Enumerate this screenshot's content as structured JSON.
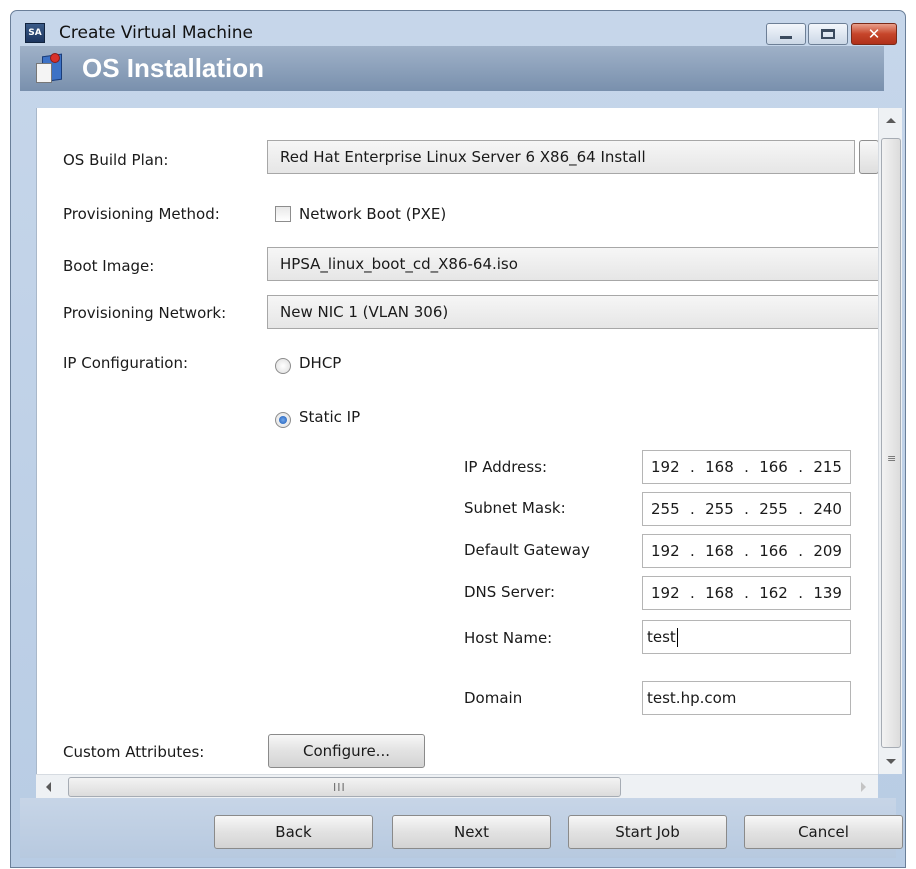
{
  "window": {
    "app_badge": "SA",
    "title": "Create Virtual Machine",
    "close_glyph": "✕"
  },
  "header": {
    "icon": "install-books-icon",
    "title": "OS Installation"
  },
  "form": {
    "os_build_plan": {
      "label": "OS Build Plan:",
      "value": "Red Hat Enterprise Linux Server 6 X86_64 Install"
    },
    "provisioning_method": {
      "label": "Provisioning Method:",
      "checkbox_label": "Network Boot (PXE)",
      "checked": false
    },
    "boot_image": {
      "label": "Boot Image:",
      "value": "HPSA_linux_boot_cd_X86-64.iso"
    },
    "provisioning_network": {
      "label": "Provisioning Network:",
      "value": "New NIC 1 (VLAN 306)"
    },
    "ip_configuration": {
      "label": "IP Configuration:",
      "options": [
        {
          "label": "DHCP",
          "selected": false
        },
        {
          "label": "Static IP",
          "selected": true
        }
      ]
    },
    "static": {
      "ip_address": {
        "label": "IP Address:",
        "octets": [
          "192",
          "168",
          "166",
          "215"
        ]
      },
      "subnet_mask": {
        "label": "Subnet Mask:",
        "octets": [
          "255",
          "255",
          "255",
          "240"
        ]
      },
      "default_gateway": {
        "label": "Default Gateway",
        "octets": [
          "192",
          "168",
          "166",
          "209"
        ]
      },
      "dns_server": {
        "label": "DNS Server:",
        "octets": [
          "192",
          "168",
          "162",
          "139"
        ]
      },
      "host_name": {
        "label": "Host Name:",
        "value": "test"
      },
      "domain": {
        "label": "Domain",
        "value": "test.hp.com"
      }
    },
    "custom_attributes": {
      "label": "Custom Attributes:",
      "button": "Configure..."
    },
    "ip_separator": "."
  },
  "scrollbars": {
    "grip_horizontal": "III",
    "grip_vertical": "≡"
  },
  "footer": {
    "back": "Back",
    "next": "Next",
    "start_job": "Start Job",
    "cancel": "Cancel"
  },
  "colors": {
    "header_gradient": [
      "#9fb1c8",
      "#7990ad"
    ],
    "window_frame": "#c6d6ea",
    "radio_selected": "#1d5bb5"
  }
}
